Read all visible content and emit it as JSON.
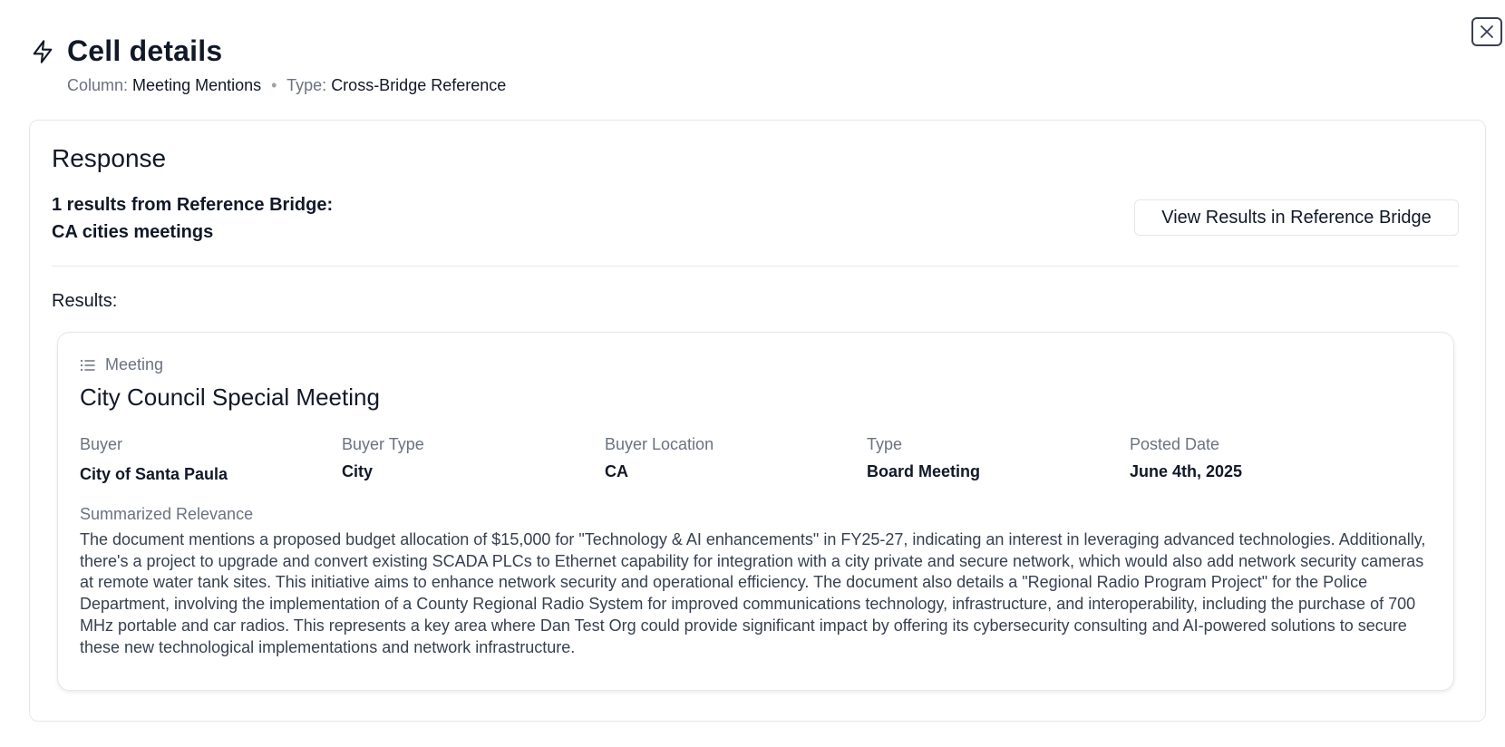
{
  "header": {
    "title": "Cell details",
    "column_label": "Column:",
    "column_value": "Meeting Mentions",
    "separator": "•",
    "type_label": "Type:",
    "type_value": "Cross-Bridge Reference"
  },
  "response": {
    "title": "Response",
    "summary_line1": "1 results from Reference Bridge:",
    "summary_line2": "CA cities meetings",
    "view_button_label": "View Results in Reference Bridge",
    "results_label": "Results:"
  },
  "result": {
    "kind": "Meeting",
    "title": "City Council Special Meeting",
    "fields": [
      {
        "label": "Buyer",
        "value": "City of Santa Paula"
      },
      {
        "label": "Buyer Type",
        "value": "City"
      },
      {
        "label": "Buyer Location",
        "value": "CA"
      },
      {
        "label": "Type",
        "value": "Board Meeting"
      },
      {
        "label": "Posted Date",
        "value": "June 4th, 2025"
      }
    ],
    "relevance_label": "Summarized Relevance",
    "relevance_text": "The document mentions a proposed budget allocation of $15,000 for \"Technology & AI enhancements\" in FY25-27, indicating an interest in leveraging advanced technologies. Additionally, there's a project to upgrade and convert existing SCADA PLCs to Ethernet capability for integration with a city private and secure network, which would also add network security cameras at remote water tank sites. This initiative aims to enhance network security and operational efficiency. The document also details a \"Regional Radio Program Project\" for the Police Department, involving the implementation of a County Regional Radio System for improved communications technology, infrastructure, and interoperability, including the purchase of 700 MHz portable and car radios. This represents a key area where Dan Test Org could provide significant impact by offering its cybersecurity consulting and AI-powered solutions to secure these new technological implementations and network infrastructure."
  },
  "icons": {
    "header": "bolt-icon",
    "close": "close-icon",
    "kind": "list-icon"
  }
}
